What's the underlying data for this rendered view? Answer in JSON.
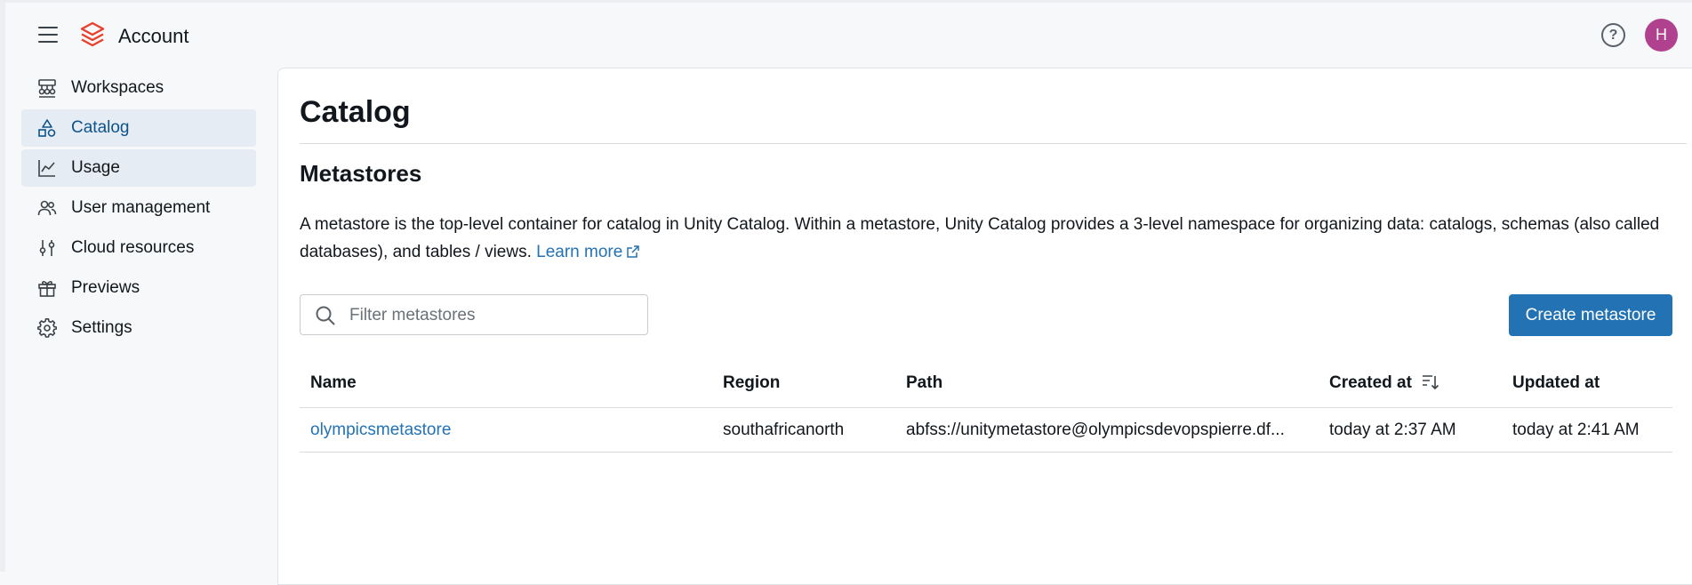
{
  "header": {
    "app_title": "Account",
    "help_label": "?",
    "avatar_initial": "H",
    "avatar_color": "#b0418f",
    "brand_color": "#e8402c"
  },
  "sidebar": {
    "items": [
      {
        "label": "Workspaces",
        "icon": "workspaces-icon",
        "active": false
      },
      {
        "label": "Catalog",
        "icon": "catalog-icon",
        "active": true
      },
      {
        "label": "Usage",
        "icon": "usage-chart-icon",
        "active": false
      },
      {
        "label": "User management",
        "icon": "users-icon",
        "active": false
      },
      {
        "label": "Cloud resources",
        "icon": "sliders-icon",
        "active": false
      },
      {
        "label": "Previews",
        "icon": "gift-icon",
        "active": false
      },
      {
        "label": "Settings",
        "icon": "gear-icon",
        "active": false
      }
    ]
  },
  "main": {
    "page_title": "Catalog",
    "section_title": "Metastores",
    "description": "A metastore is the top-level container for catalog in Unity Catalog. Within a metastore, Unity Catalog provides a 3-level namespace for organizing data: catalogs, schemas (also called databases), and tables / views.",
    "learn_more": "Learn more",
    "search": {
      "placeholder": "Filter metastores",
      "value": ""
    },
    "create_button": "Create metastore",
    "accent_color": "#2272b4",
    "table": {
      "columns": [
        "Name",
        "Region",
        "Path",
        "Created at",
        "Updated at"
      ],
      "sorted_column": "Created at",
      "rows": [
        {
          "name": "olympicsmetastore",
          "region": "southafricanorth",
          "path": "abfss://unitymetastore@olympicsdevopspierre.df...",
          "created_at": "today at 2:37 AM",
          "updated_at": "today at 2:41 AM"
        }
      ]
    }
  }
}
